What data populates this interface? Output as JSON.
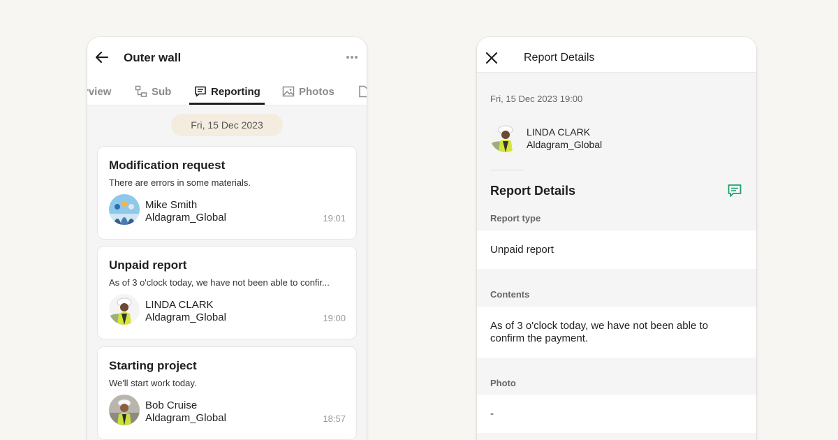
{
  "left": {
    "title": "Outer wall",
    "tabs": [
      {
        "label": "rview"
      },
      {
        "label": "Sub"
      },
      {
        "label": "Reporting"
      },
      {
        "label": "Photos"
      }
    ],
    "date_chip": "Fri, 15 Dec 2023",
    "cards": [
      {
        "title": "Modification request",
        "desc": "There are errors in some materials.",
        "name": "Mike Smith",
        "company": "Aldagram_Global",
        "time": "19:01"
      },
      {
        "title": "Unpaid report",
        "desc": "As of 3 o'clock today, we have not been able to confir...",
        "name": "LINDA CLARK",
        "company": "Aldagram_Global",
        "time": "19:00"
      },
      {
        "title": "Starting project",
        "desc": "We'll start work today.",
        "name": "Bob Cruise",
        "company": "Aldagram_Global",
        "time": "18:57"
      }
    ]
  },
  "right": {
    "title": "Report Details",
    "datetime": "Fri, 15 Dec 2023 19:00",
    "author_name": "LINDA CLARK",
    "author_company": "Aldagram_Global",
    "section_title": "Report Details",
    "report_type_label": "Report type",
    "report_type_value": "Unpaid report",
    "contents_label": "Contents",
    "contents_value": "As of 3 o'clock today, we have not been able to confirm the payment.",
    "photo_label": "Photo",
    "photo_value": "-"
  },
  "colors": {
    "accent_green": "#1aa36b",
    "date_chip_bg": "#f3ecdf"
  }
}
